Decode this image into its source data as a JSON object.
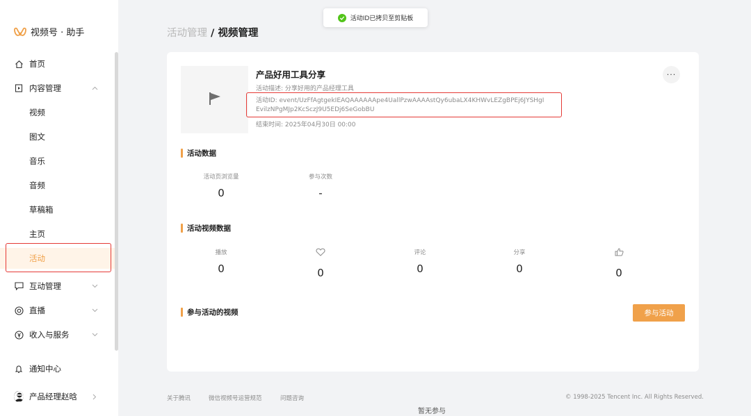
{
  "brand": {
    "name": "视频号 · 助手",
    "accent": "#f0a14a"
  },
  "nav": {
    "home": "首页",
    "content": "内容管理",
    "sub": [
      "视频",
      "图文",
      "音乐",
      "音频",
      "草稿箱",
      "主页",
      "活动"
    ],
    "interaction": "互动管理",
    "live": "直播",
    "income": "收入与服务",
    "notify": "通知中心",
    "user": "产品经理赵晗"
  },
  "breadcrumb": {
    "parent": "活动管理",
    "sep": " / ",
    "current": "视频管理"
  },
  "toast": {
    "text": "活动ID已拷贝至剪贴板"
  },
  "event": {
    "title": "产品好用工具分享",
    "desc": "活动描述: 分享好用的产品经理工具",
    "id": "活动ID: event/UzFfAgtgekIEAQAAAAAApe4UallPzwAAAAstQy6ubaLX4KHWvLEZgBPEj6JYSHgIEvilzNPgMJp2KcSczJ9U5EDj6SeGobBU",
    "end": "结束时间: 2025年04月30日 00:00",
    "more": "···"
  },
  "sections": {
    "data": "活动数据",
    "video_data": "活动视频数据",
    "videos": "参与活动的视频"
  },
  "stats": [
    {
      "label": "活动页浏览量",
      "value": "0"
    },
    {
      "label": "参与次数",
      "value": "-"
    }
  ],
  "video_stats": [
    {
      "label": "播放",
      "value": "0"
    },
    {
      "label": "",
      "value": "0",
      "icon": "heart-icon"
    },
    {
      "label": "评论",
      "value": "0"
    },
    {
      "label": "分享",
      "value": "0"
    },
    {
      "label": "",
      "value": "0",
      "icon": "thumbs-up-icon"
    }
  ],
  "join_button": "参与活动",
  "footer": {
    "links": [
      "关于腾讯",
      "微信视频号运营规范",
      "问题咨询"
    ],
    "copyright": "© 1998-2025 Tencent Inc. All Rights Reserved.",
    "bottom": "暂无参与"
  }
}
